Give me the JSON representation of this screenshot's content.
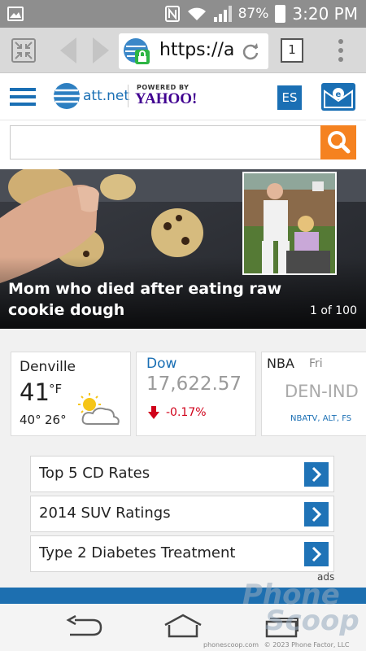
{
  "status": {
    "battery": "87%",
    "time": "3:20 PM"
  },
  "browser": {
    "url": "https://att",
    "tab_count": "1"
  },
  "header": {
    "logo_text": "att.net",
    "powered_by": "POWERED BY",
    "yahoo": "YAHOO!",
    "lang_button": "ES"
  },
  "search": {
    "placeholder": ""
  },
  "hero": {
    "headline_line1": "Mom who died after eating raw",
    "headline_line2": "cookie dough",
    "counter": "1 of 100"
  },
  "weather": {
    "city": "Denville",
    "temp": "41",
    "unit": "°F",
    "hi": "40°",
    "lo": "26°"
  },
  "stock": {
    "name": "Dow",
    "value": "17,622.57",
    "change": "-0.17%"
  },
  "sports": {
    "league": "NBA",
    "day": "Fri",
    "matchup": "DEN-IND",
    "networks": "NBATV, ALT, FS"
  },
  "links": [
    {
      "label": "Top 5 CD Rates"
    },
    {
      "label": "2014 SUV Ratings"
    },
    {
      "label": "Type 2 Diabetes Treatment"
    }
  ],
  "ads_label": "ads",
  "watermark": {
    "line1": "Phone",
    "line2": "Scoop",
    "footer_site": "phonescoop.com",
    "footer_copy": "© 2023 Phone Factor, LLC"
  }
}
